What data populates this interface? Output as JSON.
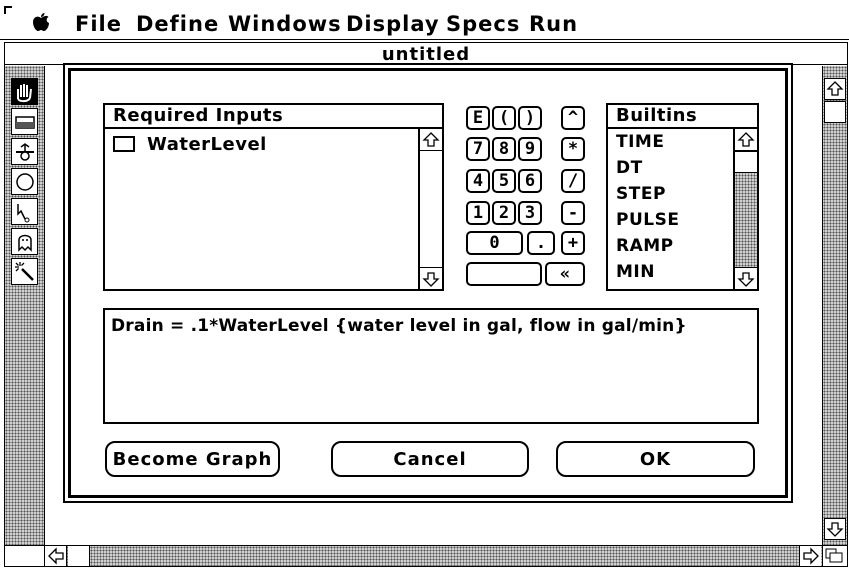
{
  "menubar": {
    "items": [
      "File",
      "Define",
      "Windows",
      "Display",
      "Specs",
      "Run"
    ]
  },
  "window": {
    "title": "untitled"
  },
  "tools": [
    {
      "name": "hand-tool-icon"
    },
    {
      "name": "stock-tool-icon"
    },
    {
      "name": "flow-tool-icon"
    },
    {
      "name": "converter-tool-icon"
    },
    {
      "name": "connector-tool-icon"
    },
    {
      "name": "ghost-tool-icon"
    },
    {
      "name": "magic-wand-tool-icon"
    }
  ],
  "dialog": {
    "required_inputs": {
      "title": "Required Inputs",
      "items": [
        "WaterLevel"
      ]
    },
    "keypad": {
      "rows": [
        [
          "E",
          "(",
          ")",
          "^"
        ],
        [
          "7",
          "8",
          "9",
          "*"
        ],
        [
          "4",
          "5",
          "6",
          "/"
        ],
        [
          "1",
          "2",
          "3",
          "-"
        ],
        [
          "0",
          ".",
          "+"
        ],
        [
          "«"
        ]
      ]
    },
    "builtins": {
      "title": "Builtins",
      "items": [
        "TIME",
        "DT",
        "STEP",
        "PULSE",
        "RAMP",
        "MIN"
      ]
    },
    "equation": "Drain = .1*WaterLevel  {water level in gal, flow in gal/min}",
    "buttons": {
      "become_graph": "Become Graph",
      "cancel": "Cancel",
      "ok": "OK"
    }
  }
}
